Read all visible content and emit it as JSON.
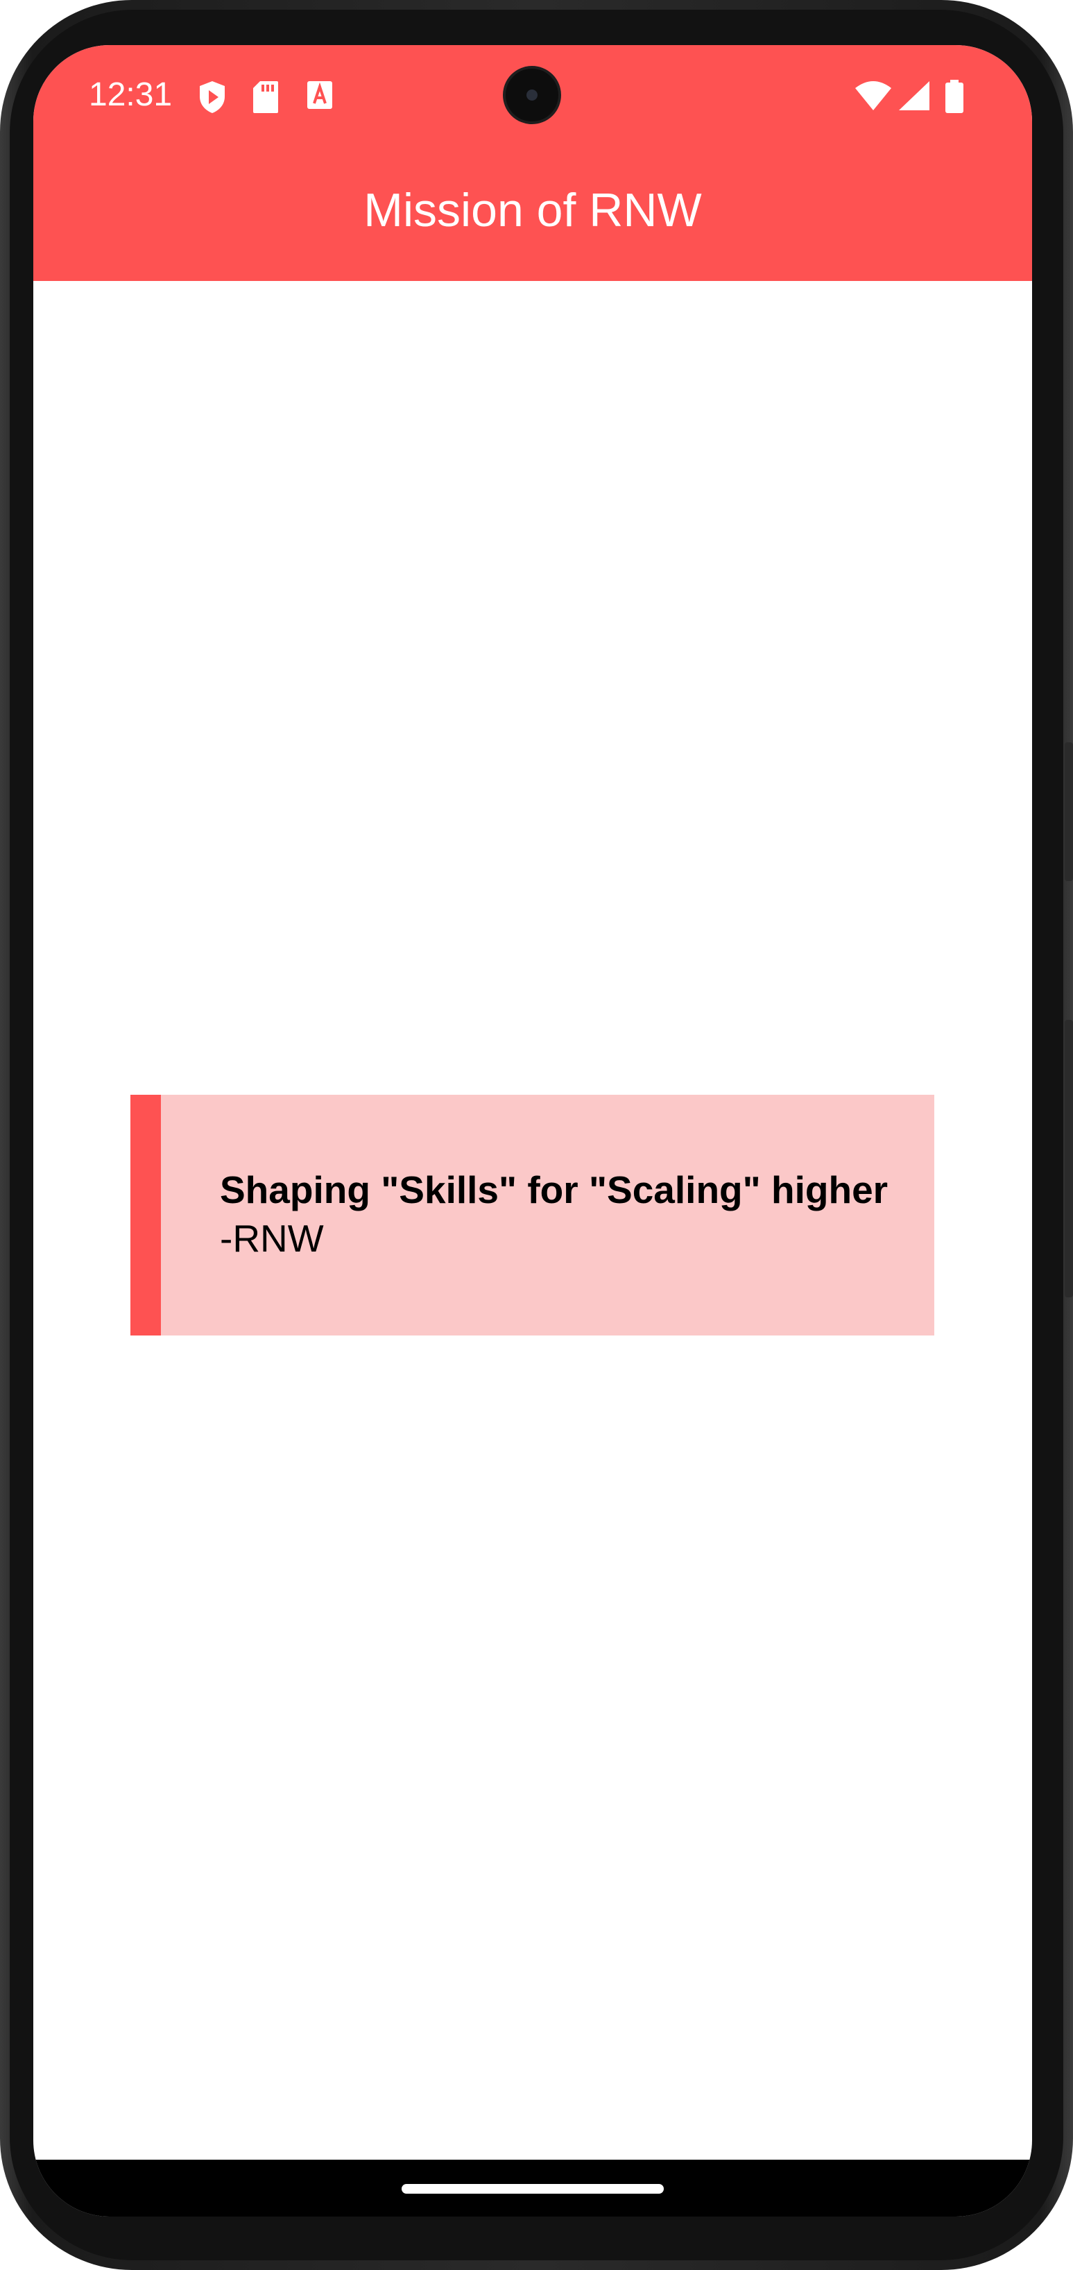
{
  "status_bar": {
    "time": "12:31",
    "left_icons": [
      "shield-play-icon",
      "sd-card-icon",
      "font-a-icon"
    ],
    "right_icons": [
      "wifi-icon",
      "cell-signal-icon",
      "battery-icon"
    ]
  },
  "app_bar": {
    "title": "Mission of RNW"
  },
  "quote": {
    "text": "Shaping \"Skills\" for \"Scaling\" higher",
    "author": "-RNW"
  },
  "colors": {
    "accent": "#fe5252",
    "card_background": "#fbc8c8",
    "nav_bar": "#000000"
  }
}
